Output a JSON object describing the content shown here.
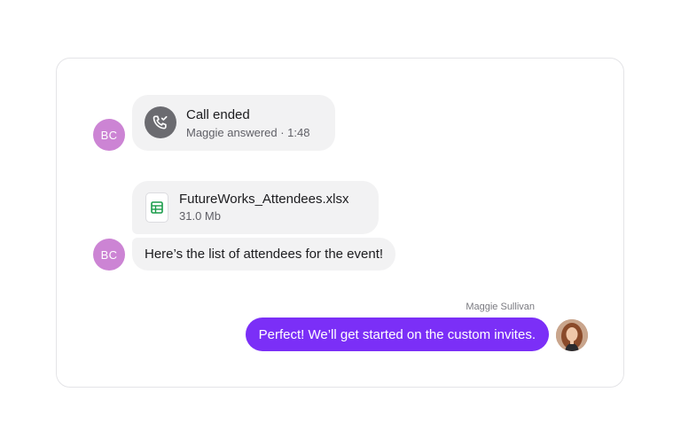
{
  "colors": {
    "avatar_bg": "#cc84d4",
    "bubble_bg": "#f2f2f3",
    "outgoing_bg": "#7b2ff7",
    "call_icon_bg": "#6b6b70",
    "spreadsheet_green": "#1a9c4a"
  },
  "conversation": {
    "messages": [
      {
        "type": "call",
        "avatar_initials": "BC",
        "icon": "phone-call-ended-icon",
        "title": "Call ended",
        "subtitle": "Maggie answered · 1:48"
      },
      {
        "type": "file",
        "icon": "spreadsheet-file-icon",
        "file_name": "FutureWorks_Attendees.xlsx",
        "file_size": "31.0 Mb"
      },
      {
        "type": "text",
        "avatar_initials": "BC",
        "text": "Here’s the list of attendees for the event!"
      },
      {
        "type": "text-outgoing",
        "sender": "Maggie Sullivan",
        "avatar": "user-photo-avatar",
        "text": "Perfect! We’ll get started on the custom invites."
      }
    ]
  }
}
